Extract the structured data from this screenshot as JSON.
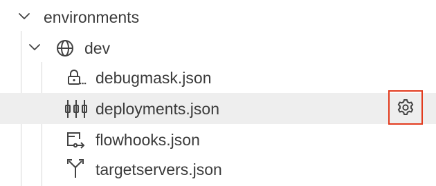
{
  "tree": {
    "root": {
      "label": "environments",
      "toggle_icon": "chevron-down-icon",
      "expanded": true
    },
    "env": {
      "label": "dev",
      "toggle_icon": "chevron-down-icon",
      "icon": "globe-icon",
      "expanded": true
    },
    "files": [
      {
        "label": "debugmask.json",
        "icon": "debug-mask-icon",
        "selected": false
      },
      {
        "label": "deployments.json",
        "icon": "deployments-icon",
        "selected": true
      },
      {
        "label": "flowhooks.json",
        "icon": "flowhooks-icon",
        "selected": false
      },
      {
        "label": "targetservers.json",
        "icon": "target-servers-icon",
        "selected": false
      }
    ],
    "row_action": {
      "icon": "gear-icon",
      "highlight_color": "#e23b1e"
    }
  },
  "colors": {
    "text": "#3b3b3b",
    "selected_row_bg": "#eeeeee",
    "indent_guide": "#d6d6d6"
  }
}
